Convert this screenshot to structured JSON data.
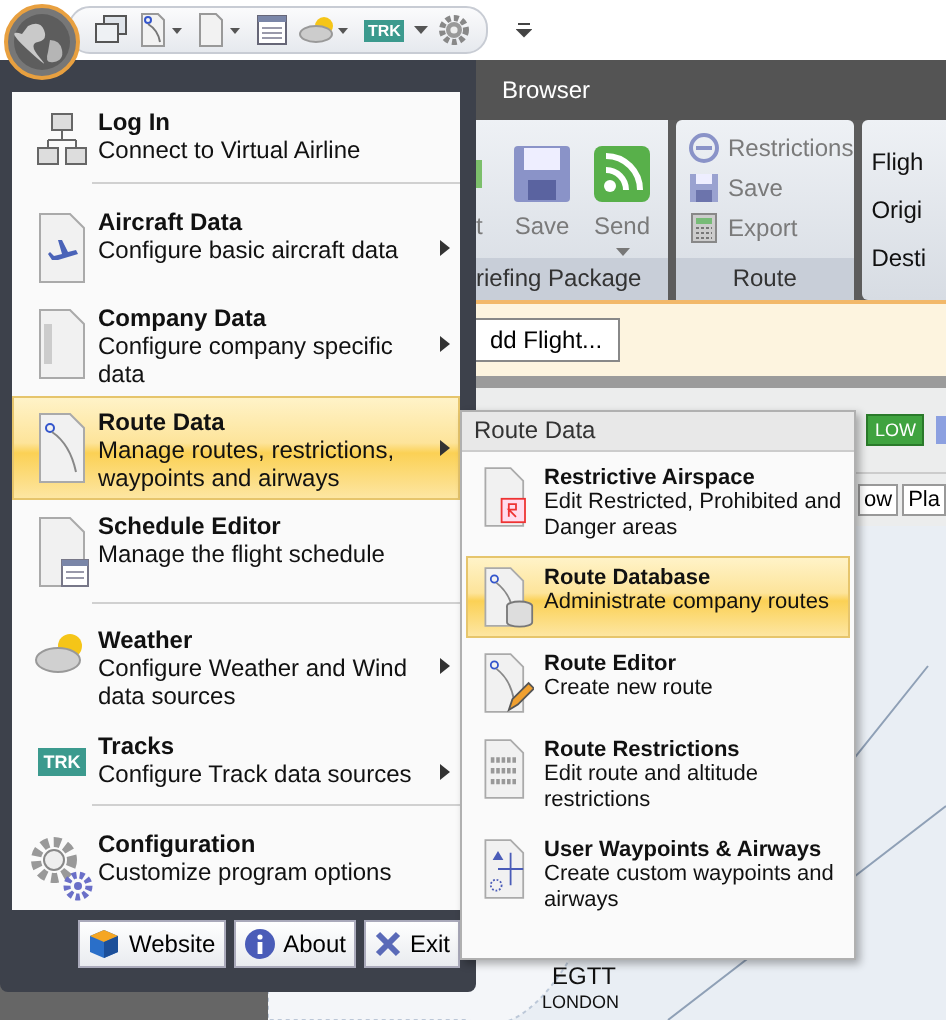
{
  "quick_access": {
    "trk_badge": "TRK"
  },
  "tab": {
    "label": "Browser"
  },
  "ribbon": {
    "groups": [
      {
        "label": "riefing Package",
        "buttons": [
          {
            "label": "t",
            "kind": "cut",
            "disabled": true
          },
          {
            "label": "Save",
            "kind": "save",
            "disabled": true
          },
          {
            "label": "Send",
            "kind": "send",
            "disabled": true
          }
        ]
      },
      {
        "label": "Route",
        "buttons": [
          {
            "label": "Restrictions",
            "kind": "restrict",
            "disabled": true
          },
          {
            "label": "Save",
            "kind": "save",
            "disabled": true
          },
          {
            "label": "Export",
            "kind": "export",
            "disabled": true
          }
        ]
      }
    ],
    "fields": [
      "Fligh",
      "Origi",
      "Desti"
    ]
  },
  "action_bar": {
    "button": "dd Flight..."
  },
  "filter_bar": {
    "badge": "LOW",
    "buttons": [
      "ow",
      "Pla"
    ]
  },
  "map": {
    "labels": [
      "EGTT",
      "LONDON"
    ]
  },
  "app_menu": {
    "items": [
      {
        "kind": "network",
        "title": "Log In",
        "description": "Connect to Virtual Airline",
        "has_submenu": false,
        "selected": false
      },
      {
        "kind": "separator"
      },
      {
        "kind": "aircraft",
        "title": "Aircraft Data",
        "description": "Configure basic aircraft data",
        "has_submenu": true,
        "selected": false
      },
      {
        "kind": "company",
        "title": "Company Data",
        "description": "Configure company specific data",
        "has_submenu": true,
        "selected": false
      },
      {
        "kind": "route",
        "title": "Route Data",
        "description": "Manage routes, restrictions, waypoints and airways",
        "has_submenu": true,
        "selected": true
      },
      {
        "kind": "schedule",
        "title": "Schedule Editor",
        "description": "Manage the flight schedule",
        "has_submenu": false,
        "selected": false
      },
      {
        "kind": "separator"
      },
      {
        "kind": "weather",
        "title": "Weather",
        "description": "Configure Weather and Wind data sources",
        "has_submenu": true,
        "selected": false
      },
      {
        "kind": "tracks",
        "title": "Tracks",
        "description": "Configure Track data sources",
        "has_submenu": true,
        "selected": false,
        "badge": "TRK"
      },
      {
        "kind": "separator"
      },
      {
        "kind": "config",
        "title": "Configuration",
        "description": "Customize program options",
        "has_submenu": false,
        "selected": false
      }
    ],
    "footer_buttons": [
      {
        "kind": "website",
        "label": "Website"
      },
      {
        "kind": "about",
        "label": "About"
      },
      {
        "kind": "exit",
        "label": "Exit"
      }
    ]
  },
  "submenu": {
    "title": "Route Data",
    "items": [
      {
        "kind": "airspace",
        "title": "Restrictive Airspace",
        "description": "Edit Restricted, Prohibited and Danger areas",
        "selected": false
      },
      {
        "kind": "database",
        "title": "Route Database",
        "description": "Administrate company routes",
        "selected": true
      },
      {
        "kind": "editor",
        "title": "Route Editor",
        "description": "Create new route",
        "selected": false
      },
      {
        "kind": "restrictions",
        "title": "Route Restrictions",
        "description": "Edit route and altitude restrictions",
        "selected": false
      },
      {
        "kind": "waypoints",
        "title": "User Waypoints & Airways",
        "description": "Create custom waypoints and airways",
        "selected": false
      }
    ]
  }
}
